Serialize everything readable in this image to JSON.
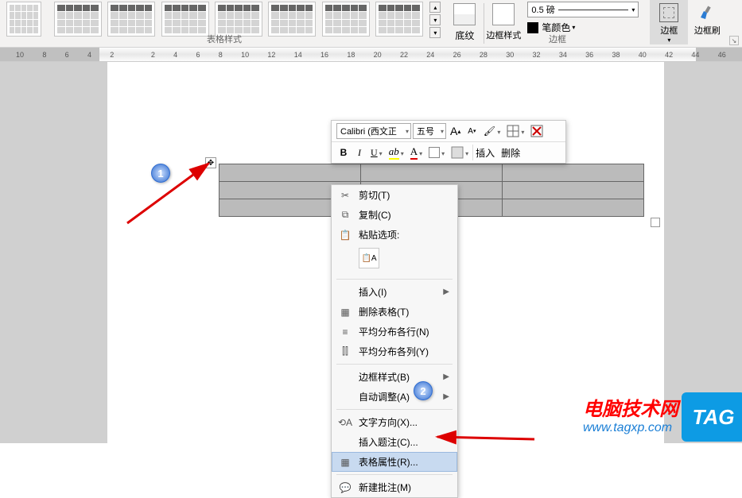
{
  "ribbon": {
    "table_styles_label": "表格样式",
    "borders_group_label": "边框",
    "shading_label": "底纹",
    "border_style_label": "边框样式",
    "pen_weight": "0.5 磅",
    "pen_color_label": "笔颜色",
    "borders_btn": "边框",
    "border_painter": "边框刷"
  },
  "ruler": [
    "10",
    "8",
    "6",
    "4",
    "2",
    "",
    "2",
    "4",
    "6",
    "8",
    "10",
    "12",
    "14",
    "16",
    "18",
    "20",
    "22",
    "24",
    "26",
    "28",
    "30",
    "32",
    "34",
    "36",
    "38",
    "40",
    "42",
    "44",
    "46"
  ],
  "mini_toolbar": {
    "font_name": "Calibri (西文正",
    "font_size": "五号",
    "grow": "A",
    "shrink": "A",
    "bold": "B",
    "italic": "I",
    "insert": "插入",
    "delete": "删除"
  },
  "context_menu": {
    "cut": "剪切(T)",
    "copy": "复制(C)",
    "paste_options": "粘贴选项:",
    "insert": "插入(I)",
    "delete_table": "删除表格(T)",
    "distribute_rows": "平均分布各行(N)",
    "distribute_cols": "平均分布各列(Y)",
    "border_styles": "边框样式(B)",
    "autofit": "自动调整(A)",
    "text_direction": "文字方向(X)...",
    "insert_caption": "插入题注(C)...",
    "table_properties": "表格属性(R)...",
    "new_comment": "新建批注(M)"
  },
  "callouts": {
    "one": "1",
    "two": "2"
  },
  "watermark": {
    "line1": "电脑技术网",
    "line2": "www.tagxp.com",
    "tag": "TAG"
  }
}
